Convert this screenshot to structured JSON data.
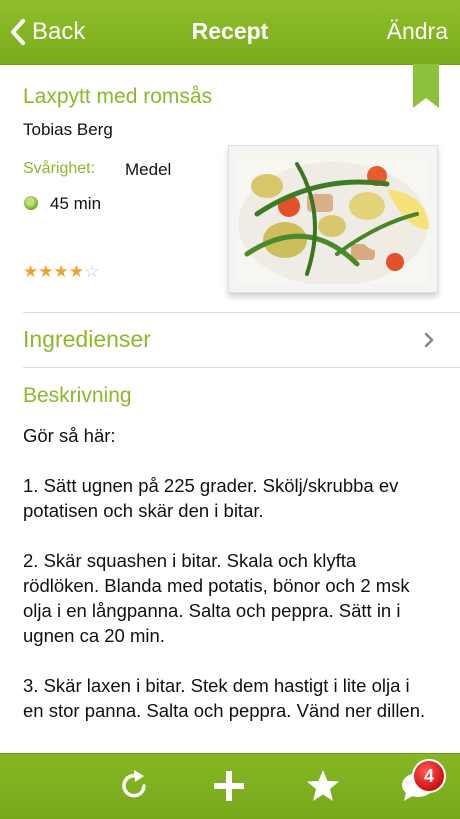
{
  "navbar": {
    "back_label": "Back",
    "title": "Recept",
    "edit_label": "Ändra"
  },
  "recipe": {
    "title": "Laxpytt med romsås",
    "author": "Tobias Berg",
    "difficulty_label": "Svårighet:",
    "difficulty_value": "Medel",
    "time": "45 min",
    "rating": 4,
    "rating_max": 5
  },
  "ingredients": {
    "label": "Ingredienser"
  },
  "description": {
    "heading": "Beskrivning",
    "body": "Gör så här:\n\n1. Sätt ugnen på 225 grader. Skölj/skrubba ev potatisen och skär den i bitar.\n\n2. Skär squashen i bitar. Skala och klyfta rödlöken. Blanda med potatis, bönor och 2 msk olja i en långpanna. Salta och peppra. Sätt in i ugnen ca 20 min.\n\n3. Skär laxen i bitar. Stek dem hastigt i lite olja i en stor panna. Salta och peppra. Vänd ner dillen."
  },
  "toolbar": {
    "icons": [
      "refresh-icon",
      "add-icon",
      "star-icon",
      "chat-icon"
    ],
    "badge_count": "4"
  },
  "colors": {
    "accent": "#8cb82a",
    "navbar": "#7aab1d",
    "badge": "#d10f0f"
  }
}
